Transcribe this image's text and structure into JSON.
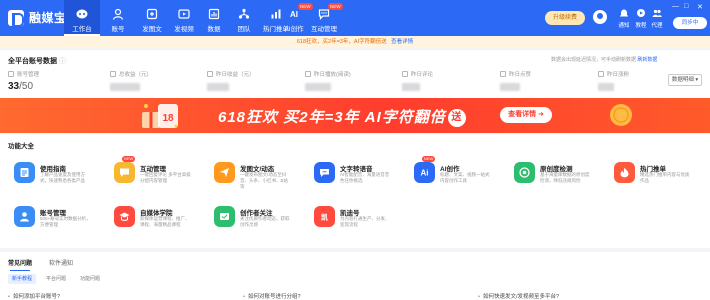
{
  "app": {
    "logo_text": "融媒宝"
  },
  "nav": {
    "items": [
      {
        "label": "工作台",
        "icon": "home-icon",
        "badge": ""
      },
      {
        "label": "账号",
        "icon": "account-icon",
        "badge": ""
      },
      {
        "label": "发图文",
        "icon": "publish-article-icon",
        "badge": ""
      },
      {
        "label": "发视频",
        "icon": "publish-video-icon",
        "badge": ""
      },
      {
        "label": "数据",
        "icon": "data-icon",
        "badge": ""
      },
      {
        "label": "团队",
        "icon": "team-icon",
        "badge": ""
      },
      {
        "label": "热门推单",
        "icon": "hot-orders-icon",
        "badge": ""
      },
      {
        "label": "AI创作",
        "icon": "ai-create-icon",
        "badge": "NEW"
      },
      {
        "label": "互动管理",
        "icon": "interaction-icon",
        "badge": "NEW"
      }
    ],
    "upgrade_label": "升级续费",
    "right_icons": [
      {
        "label": "通知",
        "icon": "bell-icon"
      },
      {
        "label": "教程",
        "icon": "tutorial-icon"
      },
      {
        "label": "代理",
        "icon": "agent-icon"
      }
    ],
    "sync_label": "同步中",
    "window_controls": [
      "—",
      "□",
      "✕"
    ]
  },
  "promo_strip": {
    "text": "618狂欢，买2年=3年，AI字符翻倍送",
    "link": "查看详情"
  },
  "account_data": {
    "title": "全平台账号数据",
    "hint": "数据会出现延迟情况，可手动刷新数据",
    "refresh_label": "刷新数据",
    "detail_button": "数据明细",
    "stats": [
      {
        "label": "账号管理",
        "value": "33",
        "sub": "/50",
        "blurred": false
      },
      {
        "label": "总收益（元）",
        "value": "",
        "sub": "",
        "blurred": true
      },
      {
        "label": "昨日收益（元）",
        "value": "",
        "sub": "",
        "blurred": true
      },
      {
        "label": "昨日播放(阅读)",
        "value": "",
        "sub": "",
        "blurred": true
      },
      {
        "label": "昨日评论",
        "value": "",
        "sub": "",
        "blurred": true
      },
      {
        "label": "昨日点赞",
        "value": "",
        "sub": "",
        "blurred": true
      },
      {
        "label": "昨日涨粉",
        "value": "",
        "sub": "",
        "blurred": true
      }
    ]
  },
  "banner": {
    "text": "618狂欢 买2年=3年 AI字符翻倍",
    "tag": "送",
    "button": "查看详情 ➜"
  },
  "features": {
    "title": "功能大全",
    "items": [
      {
        "name": "使用指南",
        "desc": "了解产品速度及使用方式，快速熟悉各类产品",
        "color": "#3a8df5",
        "icon": "guide-icon",
        "badge": ""
      },
      {
        "name": "互动管理",
        "desc": "一键回复评论 多平台高级分配内容管理",
        "color": "#f7b731",
        "icon": "interaction-manage-icon",
        "badge": "NEW"
      },
      {
        "name": "发图文/动态",
        "desc": "一键发布图文/动态至抖音、头条、小红书、B站等",
        "color": "#ff9a1f",
        "icon": "send-icon",
        "badge": ""
      },
      {
        "name": "文字转语音",
        "desc": "AI智能配音，海量语音音色任你挑选",
        "color": "#2c6af6",
        "icon": "text-to-speech-icon",
        "badge": ""
      },
      {
        "name": "AI创作",
        "desc": "标题、文案、视频一站式内容创作工具",
        "color": "#2c6af6",
        "icon": "ai-icon",
        "badge": "NEW"
      },
      {
        "name": "原创度检测",
        "desc": "基于海量库数据的原创度检测，降低违规风险",
        "color": "#2dbd6e",
        "icon": "originality-check-icon",
        "badge": ""
      },
      {
        "name": "热门推单",
        "desc": "精选热门推单内容与优质作品",
        "color": "#ff5a3c",
        "icon": "fire-icon",
        "badge": ""
      },
      {
        "name": "账号管理",
        "desc": "500+账号实时数据分析，方便管理",
        "color": "#3a8df5",
        "icon": "account-manage-icon",
        "badge": ""
      },
      {
        "name": "自媒体学院",
        "desc": "新媒体运营课程、推广、课程、海量精品课程",
        "color": "#ff4a3d",
        "icon": "academy-icon",
        "badge": ""
      },
      {
        "name": "创作者关注",
        "desc": "关注优质作者动态，获取创作灵感",
        "color": "#2dbd6e",
        "icon": "creator-follow-icon",
        "badge": ""
      },
      {
        "name": "凯迪号",
        "desc": "为内容打通生产、分发、变现流程",
        "color": "#ff4a3d",
        "icon": "kaidi-logo-icon",
        "badge": ""
      }
    ]
  },
  "faq": {
    "tabs": [
      "常见问题",
      "软件通知"
    ],
    "chips": [
      "新手教程",
      "平台问题",
      "功能问题"
    ],
    "questions": [
      "如何添加平台账号?",
      "如何对账号进行分组?",
      "如何快速发文/发视频至多平台?"
    ]
  }
}
